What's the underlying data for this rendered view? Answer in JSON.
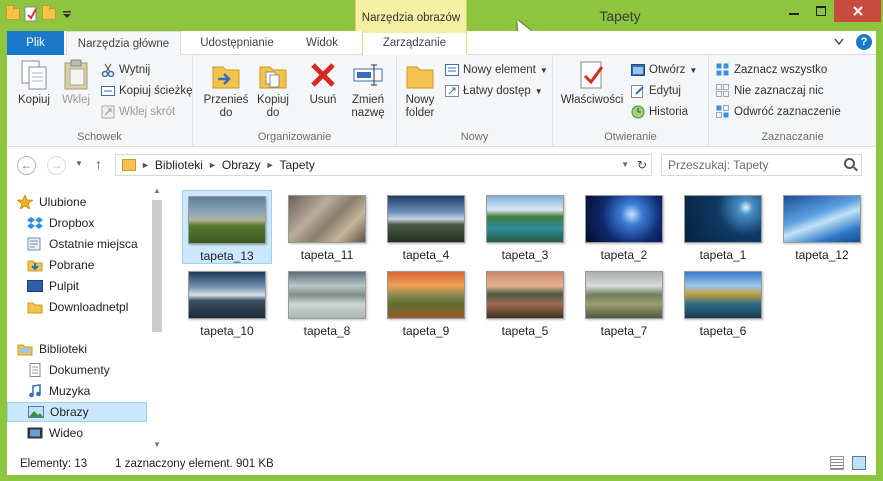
{
  "window": {
    "title": "Tapety",
    "context_tab_header": "Narzędzia obrazów",
    "accent": "#8ec53f",
    "close_color": "#c74b3e"
  },
  "tabs": {
    "file": "Plik",
    "home": "Narzędzia główne",
    "share": "Udostępnianie",
    "view": "Widok",
    "manage": "Zarządzanie"
  },
  "ribbon": {
    "schowek": {
      "label": "Schowek",
      "copy": "Kopiuj",
      "paste": "Wklej",
      "cut": "Wytnij",
      "copy_path": "Kopiuj ścieżkę",
      "paste_shortcut": "Wklej skrót"
    },
    "organizowanie": {
      "label": "Organizowanie",
      "move_to_1": "Przenieś",
      "move_to_2": "do",
      "copy_to_1": "Kopiuj",
      "copy_to_2": "do",
      "delete": "Usuń",
      "rename_1": "Zmień",
      "rename_2": "nazwę"
    },
    "nowy": {
      "label": "Nowy",
      "new_folder_1": "Nowy",
      "new_folder_2": "folder",
      "new_item": "Nowy element",
      "easy_access": "Łatwy dostęp"
    },
    "otwieranie": {
      "label": "Otwieranie",
      "properties": "Właściwości",
      "open": "Otwórz",
      "edit": "Edytuj",
      "history": "Historia"
    },
    "zaznaczanie": {
      "label": "Zaznaczanie",
      "select_all": "Zaznacz wszystko",
      "select_none": "Nie zaznaczaj nic",
      "invert": "Odwróć zaznaczenie"
    }
  },
  "address": {
    "crumbs": [
      "Biblioteki",
      "Obrazy",
      "Tapety"
    ],
    "search_placeholder": "Przeszukaj: Tapety"
  },
  "nav": {
    "favorites": "Ulubione",
    "dropbox": "Dropbox",
    "recent": "Ostatnie miejsca",
    "downloads": "Pobrane",
    "desktop": "Pulpit",
    "downloadnetpl": "Downloadnetpl",
    "libraries": "Biblioteki",
    "documents": "Dokumenty",
    "music": "Muzyka",
    "pictures": "Obrazy",
    "video": "Wideo"
  },
  "files": [
    {
      "name": "tapeta_13",
      "selected": true
    },
    {
      "name": "tapeta_11",
      "selected": false
    },
    {
      "name": "tapeta_4",
      "selected": false
    },
    {
      "name": "tapeta_3",
      "selected": false
    },
    {
      "name": "tapeta_2",
      "selected": false
    },
    {
      "name": "tapeta_1",
      "selected": false
    },
    {
      "name": "tapeta_12",
      "selected": false
    },
    {
      "name": "tapeta_10",
      "selected": false
    },
    {
      "name": "tapeta_8",
      "selected": false
    },
    {
      "name": "tapeta_9",
      "selected": false
    },
    {
      "name": "tapeta_5",
      "selected": false
    },
    {
      "name": "tapeta_7",
      "selected": false
    },
    {
      "name": "tapeta_6",
      "selected": false
    }
  ],
  "status": {
    "count": "Elementy: 13",
    "selection": "1 zaznaczony element. 901 KB"
  }
}
